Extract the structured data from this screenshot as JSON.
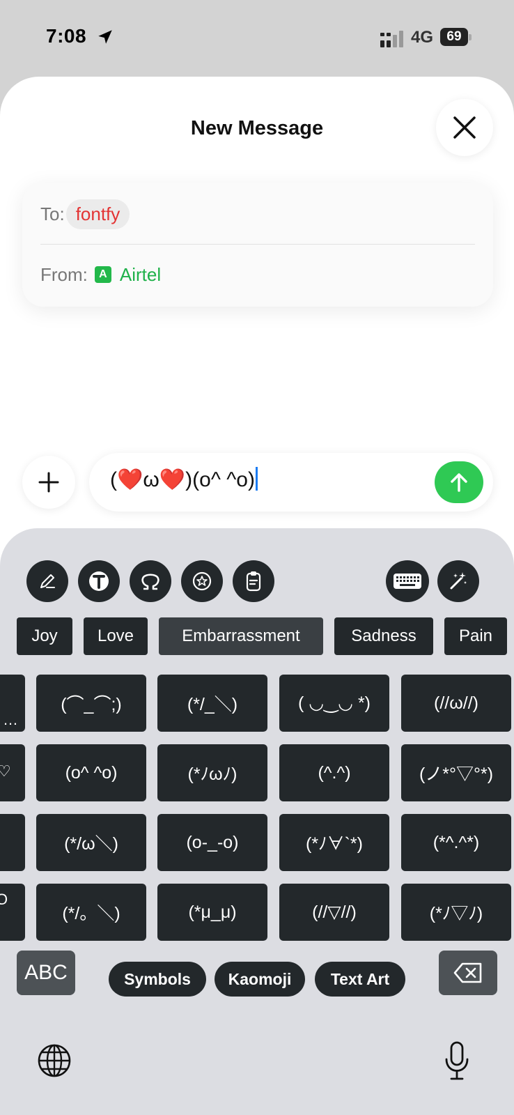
{
  "status_bar": {
    "time": "7:08",
    "network": "4G",
    "battery": "69"
  },
  "sheet": {
    "title": "New Message",
    "to_label": "To:",
    "to_recipient": "fontfy",
    "from_label": "From:",
    "sim_badge": "A",
    "from_carrier": "Airtel"
  },
  "composer": {
    "text_parts": [
      "(",
      "❤️",
      "ω",
      "❤️",
      ")(o^ ^o)"
    ]
  },
  "keyboard": {
    "categories": [
      "Joy",
      "Love",
      "Embarrassment",
      "Sadness",
      "Pain"
    ],
    "selected_category": "Embarrassment",
    "kaomoji": [
      [
        "(⌒_⌒;)",
        "(*/_＼)",
        "( ◡‿◡ *)",
        "(//ω//)"
      ],
      [
        "(o^ ^o)",
        "(*ﾉωﾉ)",
        "(^.^)",
        "(ノ*°▽°*)"
      ],
      [
        "(*/ω＼)",
        "(o-_-o)",
        "(*ﾉ∀`*)",
        "(*^.^*)"
      ],
      [
        "(*/。＼)",
        "(*μ_μ)",
        "(//▽//)",
        "(*ﾉ▽ﾉ)"
      ]
    ],
    "edge_fragments": [
      "…",
      "♡",
      "",
      "O"
    ],
    "abc_key": "ABC",
    "modes": [
      "Symbols",
      "Kaomoji",
      "Text Art"
    ],
    "icons": {
      "toolbar": [
        "pencil-icon",
        "text-format-icon",
        "omega-icon",
        "sticker-icon",
        "clipboard-icon"
      ],
      "right": [
        "keyboard-icon",
        "magic-wand-icon"
      ]
    }
  },
  "colors": {
    "send": "#2fc954",
    "recipient": "#e33333",
    "carrier": "#1fb14a",
    "key": "#23282b"
  }
}
